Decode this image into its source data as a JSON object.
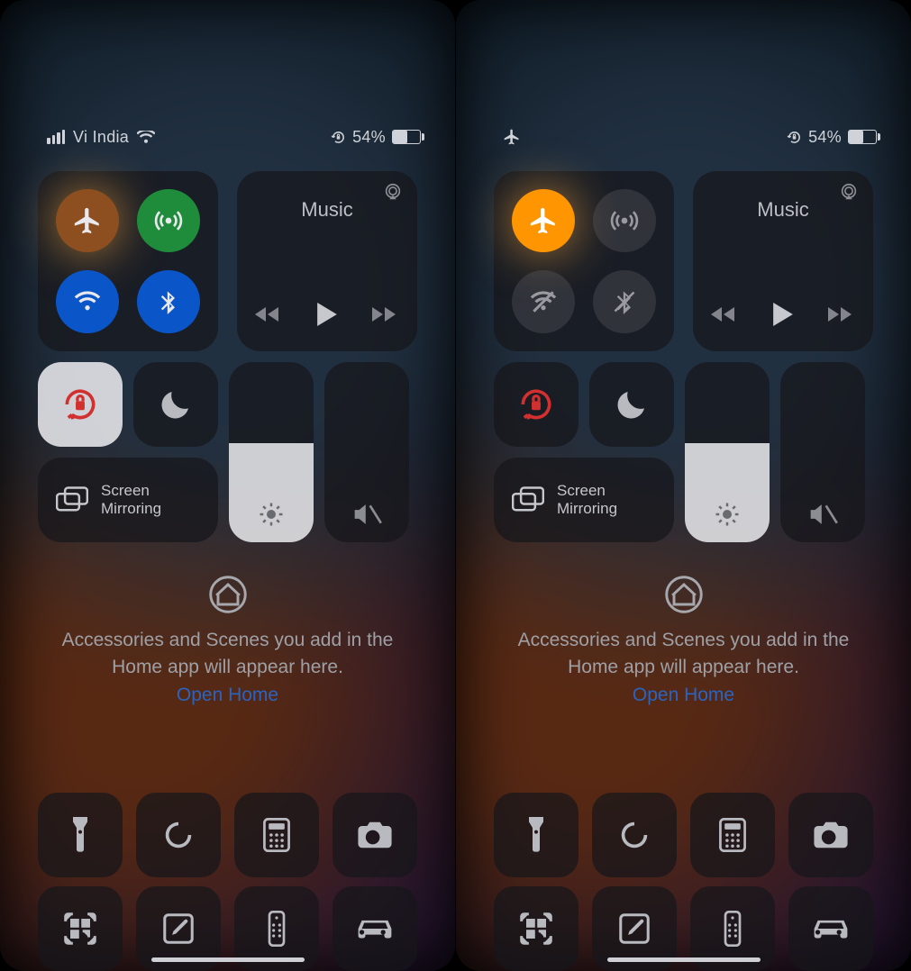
{
  "left": {
    "status": {
      "carrier": "Vi India",
      "battery_text": "54%",
      "battery_pct": 54,
      "showSignal": true,
      "showWifi": true,
      "showPlaneIcon": false
    },
    "conn": {
      "airplane": {
        "state": "pressed-dim"
      },
      "cellular": {
        "state": "on-green"
      },
      "wifi": {
        "state": "on-blue"
      },
      "bluetooth": {
        "state": "on-blue"
      }
    },
    "lock_tile_white": true,
    "music": {
      "label": "Music"
    },
    "mirror": {
      "line1": "Screen",
      "line2": "Mirroring"
    },
    "brightness_pct": 55,
    "volume_pct": 0,
    "home": {
      "text": "Accessories and Scenes you add in the Home app will appear here.",
      "link": "Open Home"
    }
  },
  "right": {
    "status": {
      "carrier": "",
      "battery_text": "54%",
      "battery_pct": 54,
      "showSignal": false,
      "showWifi": false,
      "showPlaneIcon": true
    },
    "conn": {
      "airplane": {
        "state": "on-orange"
      },
      "cellular": {
        "state": "off"
      },
      "wifi": {
        "state": "off-slash"
      },
      "bluetooth": {
        "state": "off-slash"
      }
    },
    "lock_tile_white": false,
    "music": {
      "label": "Music"
    },
    "mirror": {
      "line1": "Screen",
      "line2": "Mirroring"
    },
    "brightness_pct": 55,
    "volume_pct": 0,
    "home": {
      "text": "Accessories and Scenes you add in the Home app will appear here.",
      "link": "Open Home"
    }
  }
}
